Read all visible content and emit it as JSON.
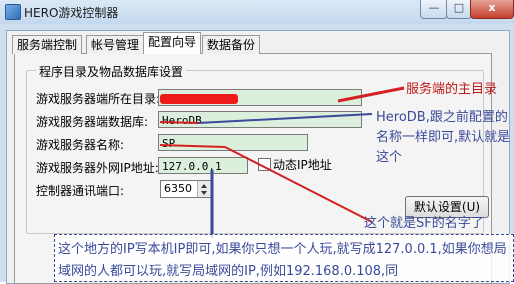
{
  "window": {
    "title": "HERO游戏控制器",
    "min_label": "—",
    "max_label": "□",
    "close_label": "x"
  },
  "tabs": [
    {
      "label": "服务端控制"
    },
    {
      "label": "帐号管理"
    },
    {
      "label": "配置向导"
    },
    {
      "label": "数据备份"
    }
  ],
  "group": {
    "title": "程序目录及物品数据库设置",
    "rows": [
      {
        "label": "游戏服务器端所在目录:",
        "value": ""
      },
      {
        "label": "游戏服务器端数据库:",
        "value": "HeroDB"
      },
      {
        "label": "游戏服务器名称:",
        "value": "SP"
      },
      {
        "label": "游戏服务器外网IP地址:",
        "value": "127.0.0.1"
      },
      {
        "label": "控制器通讯端口:",
        "value": "6350"
      }
    ],
    "dynamic_ip_label": "动态IP地址",
    "default_button": "默认设置(U)"
  },
  "annotations": {
    "server_dir": "服务端的主目录",
    "db_note": "HeroDB,跟之前配置的名称一样即可,默认就是这个",
    "sf_name": "这个就是SF的名字了",
    "ip_hint": "这个地方的IP写本机IP即可,如果你只想一个人玩,就写成127.0.0.1,如果你想局域网的人都可以玩,就写局域网的IP,例如192.168.0.108,同"
  },
  "colors": {
    "field_bg": "#dcefdc",
    "annotation_red": "#c01818",
    "annotation_blue": "#3a4a9a"
  }
}
